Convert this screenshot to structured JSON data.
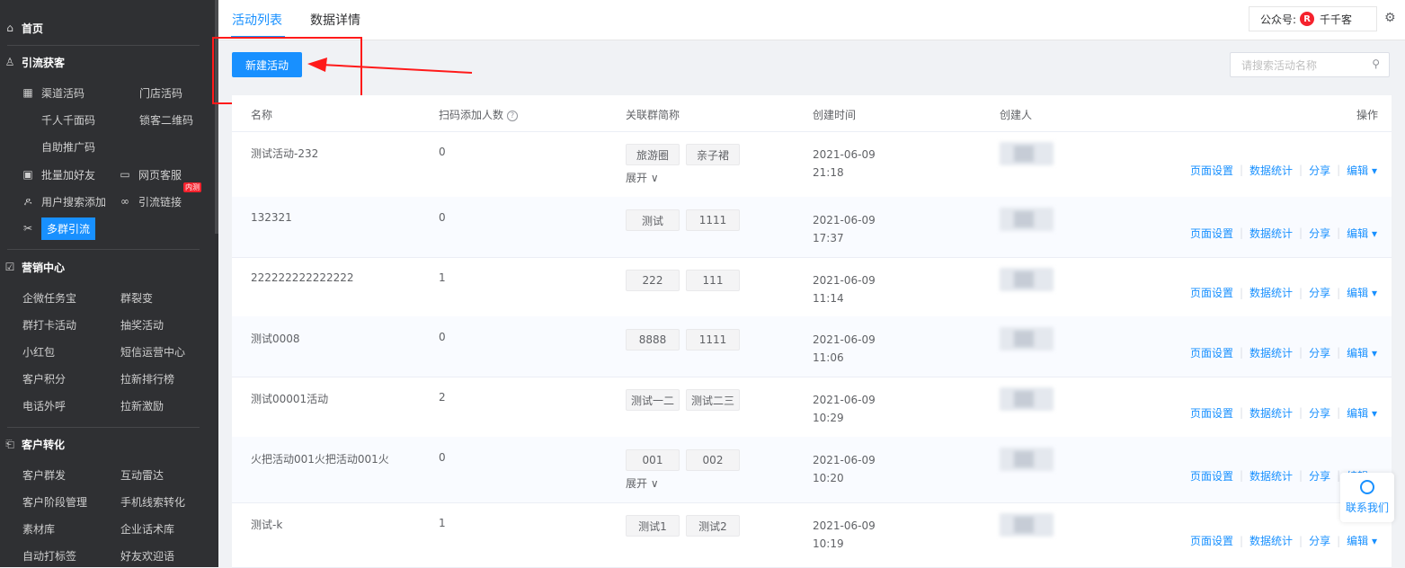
{
  "sidebar": {
    "sections": [
      {
        "icon": "home-icon",
        "label": "首页"
      },
      {
        "icon": "user-acquire-icon",
        "label": "引流获客"
      },
      {
        "icon": "marketing-icon",
        "label": "营销中心"
      },
      {
        "icon": "conversion-icon",
        "label": "客户转化"
      }
    ],
    "acquire": {
      "channel_code": "渠道活码",
      "store_code": "门店活码",
      "personal_code": "千人千面码",
      "lock_qr": "锁客二维码",
      "self_promo": "自助推广码",
      "batch_add": "批量加好友",
      "web_service": "网页客服",
      "web_service_badge": "内测",
      "user_search": "用户搜索添加",
      "link": "引流链接",
      "multi_group": "多群引流"
    },
    "marketing": [
      "企微任务宝",
      "群裂变",
      "群打卡活动",
      "抽奖活动",
      "小红包",
      "短信运营中心",
      "客户积分",
      "拉新排行榜",
      "电话外呼",
      "拉新激励"
    ],
    "conversion": [
      "客户群发",
      "互动雷达",
      "客户阶段管理",
      "手机线索转化",
      "素材库",
      "企业话术库",
      "自动打标签",
      "好友欢迎语"
    ]
  },
  "topbar": {
    "tabs": [
      "活动列表",
      "数据详情"
    ],
    "account_label": "公众号:",
    "account_logo": "R",
    "account_name": "千千客"
  },
  "toolbar": {
    "new_button": "新建活动",
    "search_placeholder": "请搜索活动名称"
  },
  "table": {
    "headers": {
      "name": "名称",
      "count": "扫码添加人数",
      "help": "?",
      "groups": "关联群简称",
      "created": "创建时间",
      "creator": "创建人",
      "ops": "操作"
    },
    "expand_label": "展开 ∨",
    "ops": {
      "page": "页面设置",
      "stats": "数据统计",
      "share": "分享",
      "edit": "编辑 ▾"
    },
    "rows": [
      {
        "name": "测试活动-232",
        "count": "0",
        "tags": [
          "旅游圈",
          "亲子裙"
        ],
        "expand": true,
        "date": "2021-06-09",
        "time": "21:18"
      },
      {
        "name": "132321",
        "count": "0",
        "tags": [
          "测试",
          "1111"
        ],
        "expand": false,
        "date": "2021-06-09",
        "time": "17:37"
      },
      {
        "name": "222222222222222",
        "count": "1",
        "tags": [
          "222",
          "111"
        ],
        "expand": false,
        "date": "2021-06-09",
        "time": "11:14"
      },
      {
        "name": "测试0008",
        "count": "0",
        "tags": [
          "8888",
          "1111"
        ],
        "expand": false,
        "date": "2021-06-09",
        "time": "11:06"
      },
      {
        "name": "测试00001活动",
        "count": "2",
        "tags": [
          "测试一二",
          "测试二三"
        ],
        "expand": false,
        "date": "2021-06-09",
        "time": "10:29"
      },
      {
        "name": "火把活动001火把活动001火",
        "count": "0",
        "tags": [
          "001",
          "002"
        ],
        "expand": true,
        "date": "2021-06-09",
        "time": "10:20"
      },
      {
        "name": "测试-k",
        "count": "1",
        "tags": [
          "测试1",
          "测试2"
        ],
        "expand": false,
        "date": "2021-06-09",
        "time": "10:19"
      }
    ]
  },
  "contact": {
    "label": "联系我们"
  },
  "colors": {
    "accent": "#1890ff",
    "sidebar": "#2f3033",
    "highlight": "#ff1a1a"
  }
}
